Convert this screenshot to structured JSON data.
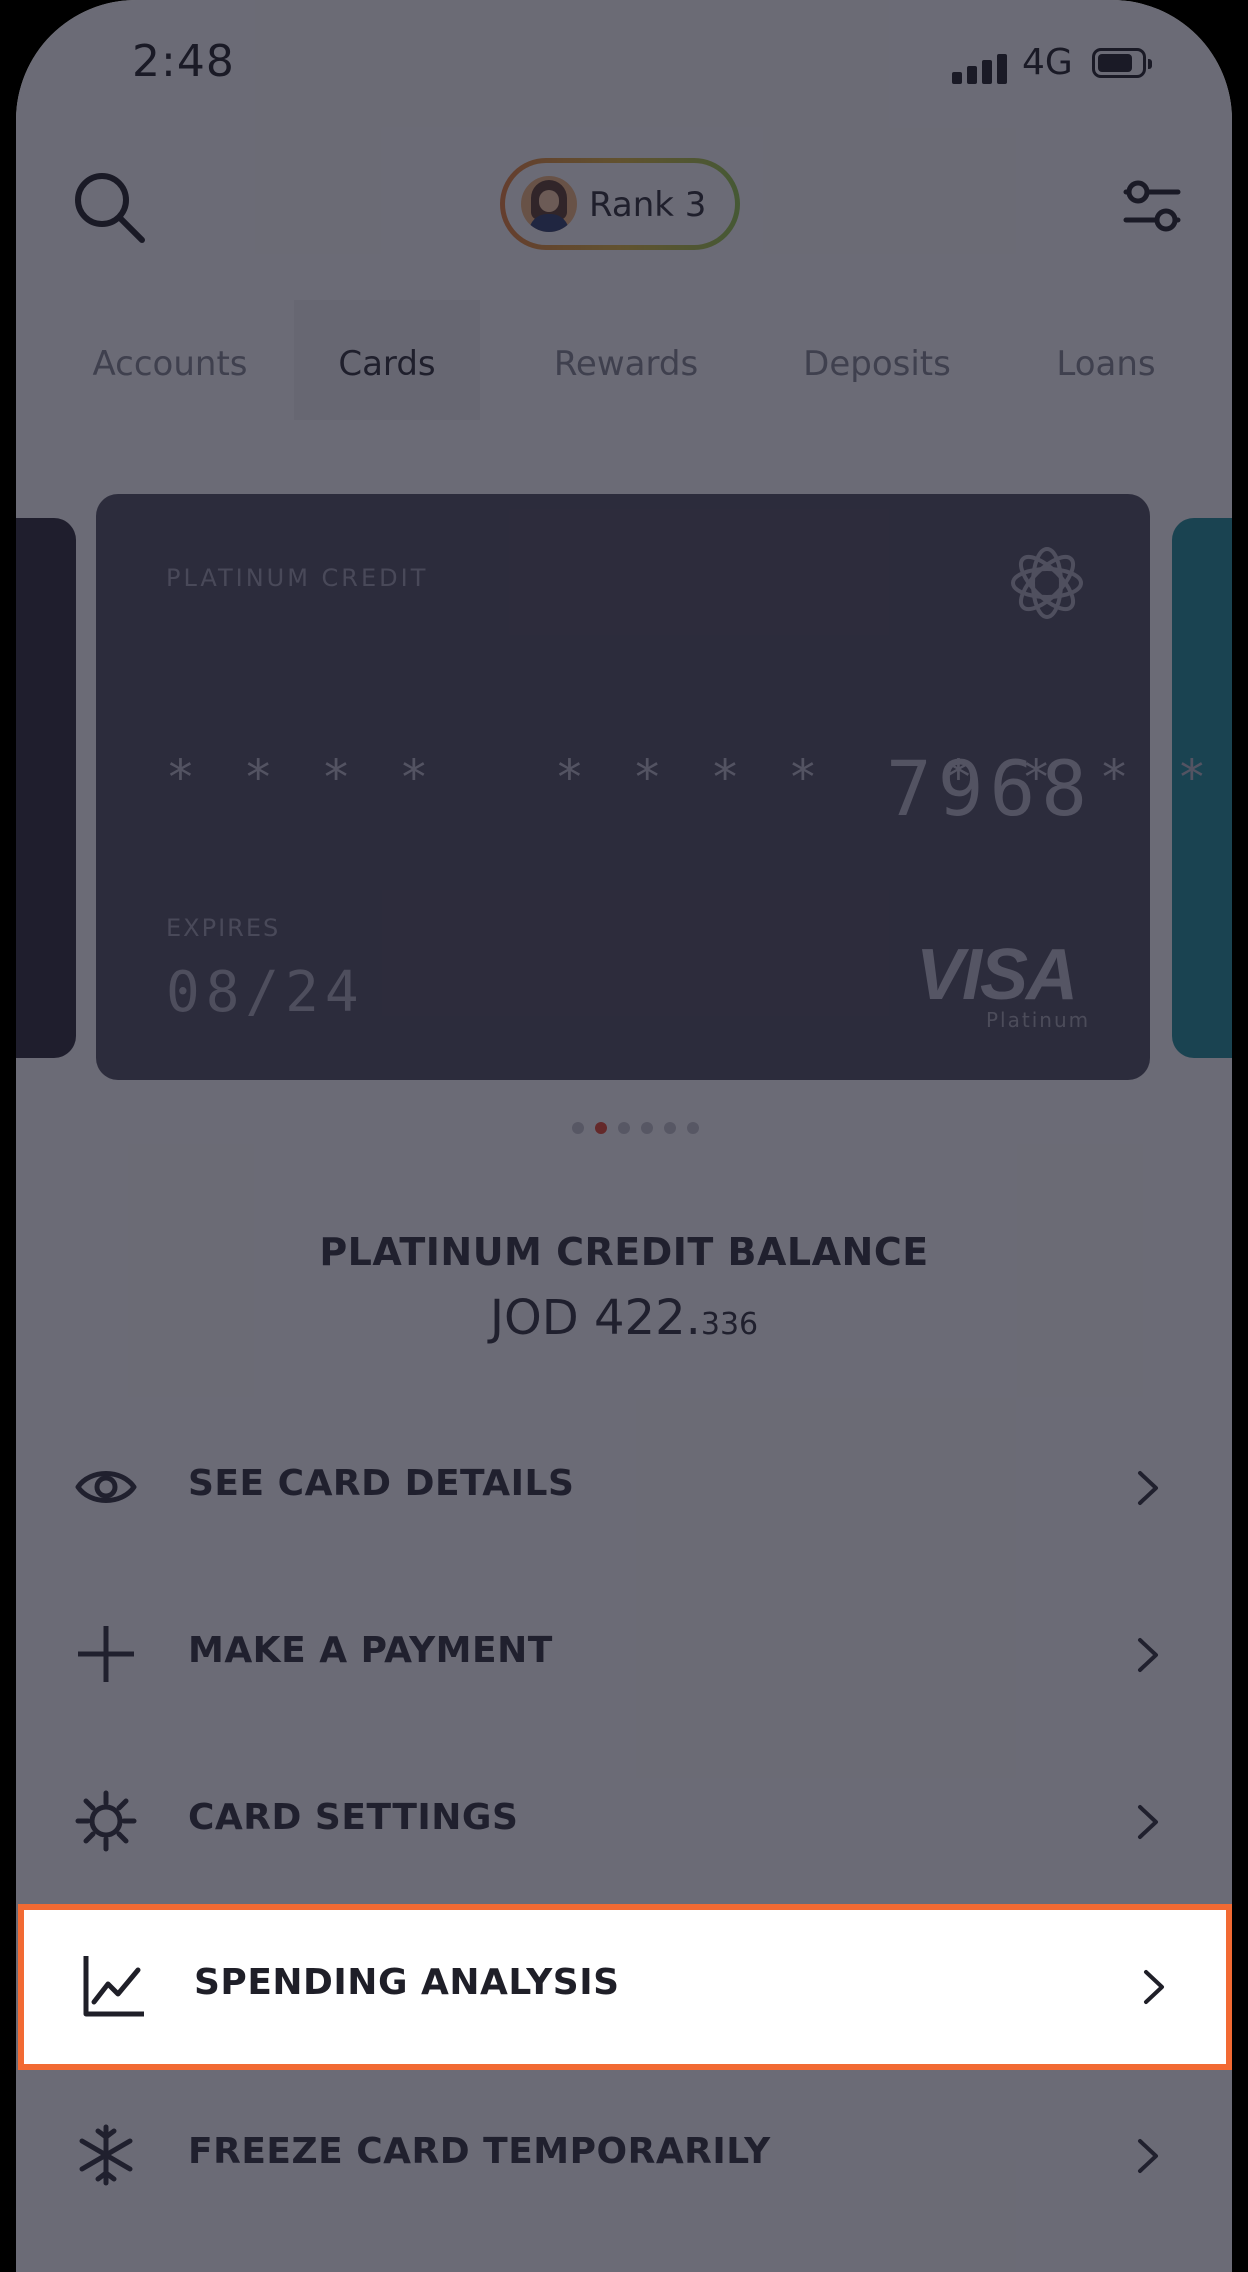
{
  "status_bar": {
    "time": "2:48",
    "network": "4G"
  },
  "header": {
    "rank_label": "Rank 3"
  },
  "tabs": [
    {
      "label": "Accounts",
      "active": false
    },
    {
      "label": "Cards",
      "active": true
    },
    {
      "label": "Rewards",
      "active": false
    },
    {
      "label": "Deposits",
      "active": false
    },
    {
      "label": "Loans",
      "active": false
    }
  ],
  "card": {
    "type": "PLATINUM CREDIT",
    "masked_number": "* * * *   * * * *   * * * *",
    "last4": "7968",
    "expires_label": "EXPIRES",
    "expires_value": "08/24",
    "network": "VISA",
    "network_tier": "Platinum"
  },
  "carousel": {
    "count": 6,
    "active_index": 1,
    "active_color": "#e0442f"
  },
  "balance": {
    "label": "PLATINUM CREDIT BALANCE",
    "currency_whole": "JOD 422.",
    "decimals": "336"
  },
  "menu": [
    {
      "label": "SEE CARD DETAILS",
      "icon": "eye-icon"
    },
    {
      "label": "MAKE A PAYMENT",
      "icon": "plus-icon"
    },
    {
      "label": "CARD SETTINGS",
      "icon": "gear-icon"
    },
    {
      "label": "SPENDING ANALYSIS",
      "icon": "chart-line-icon",
      "highlighted": true
    },
    {
      "label": "FREEZE CARD TEMPORARILY",
      "icon": "snowflake-icon"
    }
  ],
  "colors": {
    "highlight_border": "#f26a33",
    "card_bg": "#4e4d5d",
    "right_card_peek": "#1d8a93"
  }
}
